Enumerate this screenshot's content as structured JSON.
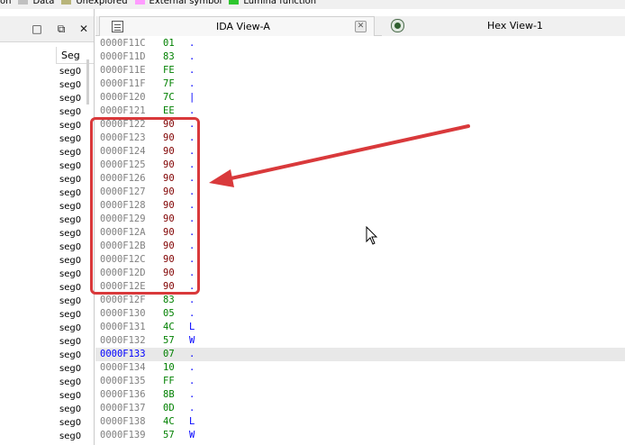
{
  "legend": [
    {
      "label": "on",
      "color": null
    },
    {
      "label": "Data",
      "color": "#c0c0c0"
    },
    {
      "label": "Unexplored",
      "color": "#b8b47a"
    },
    {
      "label": "External symbol",
      "color": "#ff9cff"
    },
    {
      "label": "Lumina function",
      "color": "#2ec62e"
    }
  ],
  "left_pane": {
    "column_header": "Seg",
    "row_label": "seg0"
  },
  "tabs": {
    "ida_view": "IDA View-A",
    "hex_view": "Hex View-1"
  },
  "rows": [
    {
      "addr": "0000F11C",
      "byte": "01",
      "ch": "."
    },
    {
      "addr": "0000F11D",
      "byte": "83",
      "ch": "."
    },
    {
      "addr": "0000F11E",
      "byte": "FE",
      "ch": "."
    },
    {
      "addr": "0000F11F",
      "byte": "7F",
      "ch": "."
    },
    {
      "addr": "0000F120",
      "byte": "7C",
      "ch": "|"
    },
    {
      "addr": "0000F121",
      "byte": "EE",
      "ch": "."
    },
    {
      "addr": "0000F122",
      "byte": "90",
      "ch": "."
    },
    {
      "addr": "0000F123",
      "byte": "90",
      "ch": "."
    },
    {
      "addr": "0000F124",
      "byte": "90",
      "ch": "."
    },
    {
      "addr": "0000F125",
      "byte": "90",
      "ch": "."
    },
    {
      "addr": "0000F126",
      "byte": "90",
      "ch": "."
    },
    {
      "addr": "0000F127",
      "byte": "90",
      "ch": "."
    },
    {
      "addr": "0000F128",
      "byte": "90",
      "ch": "."
    },
    {
      "addr": "0000F129",
      "byte": "90",
      "ch": "."
    },
    {
      "addr": "0000F12A",
      "byte": "90",
      "ch": "."
    },
    {
      "addr": "0000F12B",
      "byte": "90",
      "ch": "."
    },
    {
      "addr": "0000F12C",
      "byte": "90",
      "ch": "."
    },
    {
      "addr": "0000F12D",
      "byte": "90",
      "ch": "."
    },
    {
      "addr": "0000F12E",
      "byte": "90",
      "ch": "."
    },
    {
      "addr": "0000F12F",
      "byte": "83",
      "ch": "."
    },
    {
      "addr": "0000F130",
      "byte": "05",
      "ch": "."
    },
    {
      "addr": "0000F131",
      "byte": "4C",
      "ch": "L"
    },
    {
      "addr": "0000F132",
      "byte": "57",
      "ch": "W"
    },
    {
      "addr": "0000F133",
      "byte": "07",
      "ch": "."
    },
    {
      "addr": "0000F134",
      "byte": "10",
      "ch": "."
    },
    {
      "addr": "0000F135",
      "byte": "FF",
      "ch": "."
    },
    {
      "addr": "0000F136",
      "byte": "8B",
      "ch": "."
    },
    {
      "addr": "0000F137",
      "byte": "0D",
      "ch": "."
    },
    {
      "addr": "0000F138",
      "byte": "4C",
      "ch": "L"
    },
    {
      "addr": "0000F139",
      "byte": "57",
      "ch": "W"
    }
  ],
  "patched_range": [
    "0000F122",
    "0000F12E"
  ],
  "current_address": "0000F133",
  "colors": {
    "address": "#808080",
    "address_selected": "#0000ff",
    "byte": "#008000",
    "byte_patched": "#800000",
    "char": "#0000ff",
    "annotation": "#d9393b"
  },
  "icons": [
    "restore-icon",
    "float-icon",
    "close-icon",
    "listing-icon",
    "hex-view-icon",
    "tab-close-icon",
    "annotation-arrow",
    "mouse-cursor"
  ]
}
